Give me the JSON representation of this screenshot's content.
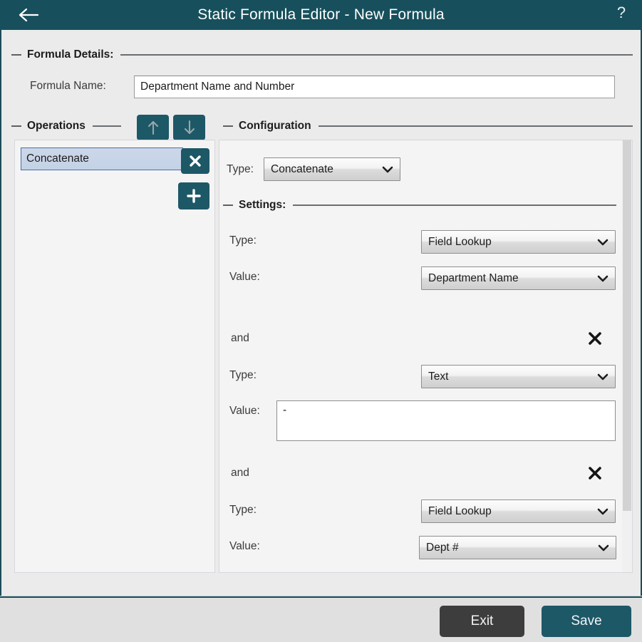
{
  "titlebar": {
    "title": "Static Formula Editor - New Formula",
    "back_icon": "back-arrow-icon",
    "help_label": "?"
  },
  "formula_details": {
    "group_label": "Formula Details:",
    "name_label": "Formula Name:",
    "name_value": "Department Name and Number",
    "name_placeholder": ""
  },
  "operations": {
    "group_label": "Operations",
    "move_up_icon": "arrow-up-icon",
    "move_down_icon": "arrow-down-icon",
    "delete_icon": "close-x-icon",
    "add_icon": "plus-icon",
    "items": [
      {
        "label": "Concatenate",
        "selected": true
      }
    ]
  },
  "configuration": {
    "group_label": "Configuration",
    "type_label": "Type:",
    "type_value": "Concatenate",
    "settings_label": "Settings:",
    "and_label": "and",
    "remove_icon": "close-x-icon",
    "caret_icon": "chevron-down-icon",
    "groups": [
      {
        "type_label": "Type:",
        "type_value": "Field Lookup",
        "value_label": "Value:",
        "value_value": "Department Name",
        "value_kind": "select"
      },
      {
        "type_label": "Type:",
        "type_value": "Text",
        "value_label": "Value:",
        "value_value": "-",
        "value_kind": "textarea"
      },
      {
        "type_label": "Type:",
        "type_value": "Field Lookup",
        "value_label": "Value:",
        "value_value": "Dept #",
        "value_kind": "select"
      }
    ]
  },
  "footer": {
    "exit_label": "Exit",
    "save_label": "Save"
  },
  "colors": {
    "titlebar_bg": "#17505c",
    "teal_button": "#1d5867",
    "dark_button": "#3d3d3d",
    "page_bg": "#ebebeb",
    "panel_bg": "#f4f4f4",
    "selected_row": "#c9d6e8"
  }
}
